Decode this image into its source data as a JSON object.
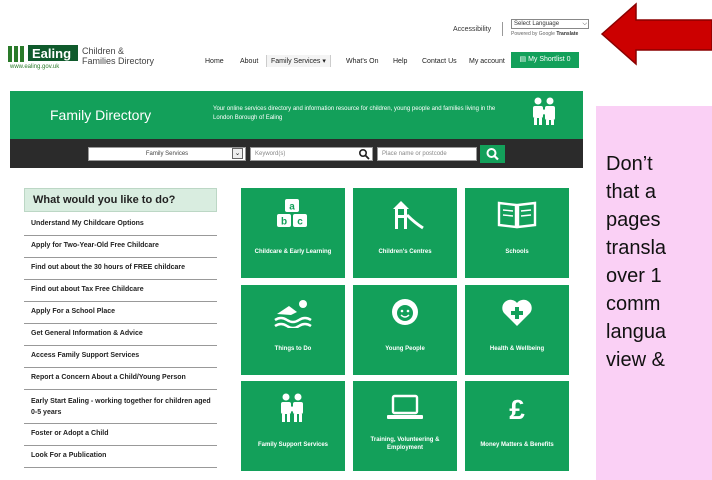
{
  "topbar": {
    "accessibility": "Accessibility",
    "language_select": "Select Language",
    "powered_by": "Powered by Google",
    "translate": "Translate"
  },
  "logo": {
    "wordmark": "Ealing",
    "url": "www.ealing.gov.uk",
    "title_line1": "Children &",
    "title_line2": "Families Directory"
  },
  "nav": {
    "home": "Home",
    "about": "About",
    "family_services": "Family Services",
    "whats_on": "What's On",
    "help": "Help",
    "contact": "Contact Us",
    "account": "My account",
    "shortlist": "My Shortlist",
    "shortlist_count": "0"
  },
  "hero": {
    "title": "Family Directory",
    "description": "Your online services directory and information resource for children, young people and families living in the London Borough of Ealing"
  },
  "search": {
    "category": "Family Services",
    "keyword_placeholder": "Keyword(s)",
    "place_placeholder": "Place name or postcode"
  },
  "menu": {
    "heading": "What would you like to do?",
    "items": [
      "Understand My Childcare Options",
      "Apply for Two-Year-Old Free Childcare",
      "Find out about the 30 hours of FREE childcare",
      "Find out about Tax Free Childcare",
      "Apply For a School Place",
      "Get General Information & Advice",
      "Access Family Support Services",
      "Report a Concern About a Child/Young Person",
      "Early Start Ealing - working together for children aged 0-5 years",
      "Foster or Adopt a Child",
      "Look For a Publication"
    ]
  },
  "tiles": [
    "Childcare & Early Learning",
    "Children's Centres",
    "Schools",
    "Things to Do",
    "Young People",
    "Health & Wellbeing",
    "Family Support Services",
    "Training, Volunteering & Employment",
    "Money Matters & Benefits"
  ],
  "note": {
    "lines": [
      "Don’t",
      "that a",
      "pages",
      "transla",
      "over 1",
      "comm",
      "langua",
      "view &"
    ]
  },
  "colors": {
    "brand_green": "#13a05a",
    "search_bar": "#2b2b2b",
    "note_pink": "#fad0f5",
    "arrow_red": "#cc0000"
  }
}
